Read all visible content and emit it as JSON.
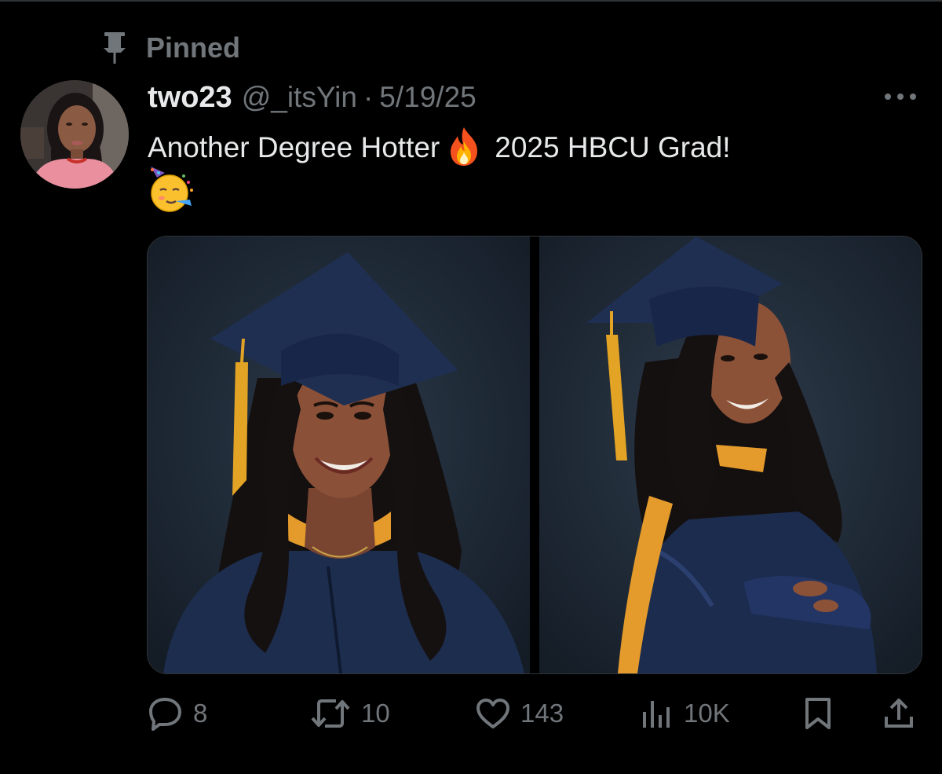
{
  "pinned": {
    "label": "Pinned"
  },
  "author": {
    "display_name": "two23",
    "handle": "@_itsYin",
    "separator": "·",
    "timestamp": "5/19/25"
  },
  "tweet": {
    "text_before_fire": "Another Degree Hotter",
    "text_after_fire": "2025 HBCU Grad!",
    "emojis": [
      "fire",
      "partying-face"
    ]
  },
  "media": {
    "photos": [
      {
        "description_icon": "graduate-portrait-front"
      },
      {
        "description_icon": "graduate-portrait-side"
      }
    ]
  },
  "actions": {
    "reply_count": "8",
    "repost_count": "10",
    "like_count": "143",
    "views_count": "10K"
  },
  "colors": {
    "background": "#000000",
    "primary_text": "#e7e9ea",
    "secondary_text": "#71767b",
    "border": "#2f3336"
  }
}
